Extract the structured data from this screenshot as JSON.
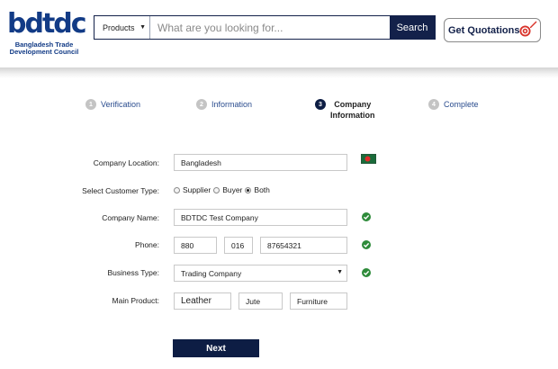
{
  "header": {
    "logo": {
      "word": "bdtdc",
      "tagline_line1": "Bangladesh Trade",
      "tagline_line2": "Development Council"
    },
    "search": {
      "category": "Products",
      "placeholder": "What are you looking for...",
      "button_label": "Search"
    },
    "quote_button_label": "Get Quotations"
  },
  "steps": [
    {
      "number": "1",
      "label": "Verification",
      "active": false
    },
    {
      "number": "2",
      "label": "Information",
      "active": false
    },
    {
      "number": "3",
      "label_line1": "Company",
      "label_line2": "Information",
      "active": true
    },
    {
      "number": "4",
      "label": "Complete",
      "active": false
    }
  ],
  "form": {
    "company_location": {
      "label": "Company Location:",
      "value": "Bangladesh",
      "flag_icon": "bangladesh-flag-icon"
    },
    "customer_type": {
      "label": "Select Customer Type:",
      "options": [
        {
          "label": "Supplier",
          "checked": false
        },
        {
          "label": "Buyer",
          "checked": false
        },
        {
          "label": "Both",
          "checked": true
        }
      ]
    },
    "company_name": {
      "label": "Company Name:",
      "value": "BDTDC Test Company",
      "valid": true
    },
    "phone": {
      "label": "Phone:",
      "country_code": "880",
      "area_code": "016",
      "number": "87654321",
      "valid": true
    },
    "business_type": {
      "label": "Business Type:",
      "value": "Trading Company",
      "valid": true
    },
    "main_product": {
      "label": "Main Product:",
      "values": [
        "Leather",
        "Jute",
        "Furniture"
      ]
    },
    "next_button_label": "Next"
  },
  "colors": {
    "brand_navy": "#13214a",
    "step_active": "#0d1d44",
    "link_blue": "#2a4c8e",
    "check_green": "#2e8b3a"
  }
}
